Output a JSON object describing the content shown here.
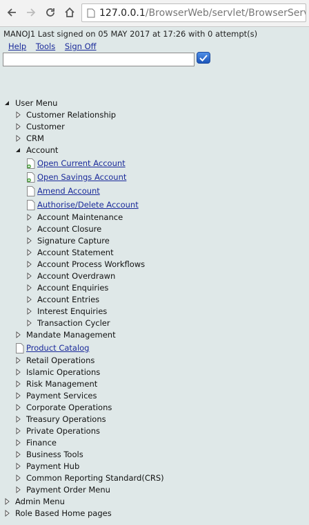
{
  "browser": {
    "url_host": "127.0.0.1",
    "url_path": "/BrowserWeb/servlet/BrowserServlet"
  },
  "header": {
    "signed_in_text": "MANOJ1 Last signed on 05 MAY 2017 at 17:26 with 0 attempt(s)",
    "links": [
      "Help",
      "Tools",
      "Sign Off"
    ],
    "command_value": ""
  },
  "menu": {
    "root": "User Menu",
    "items_level1_top": [
      "Customer Relationship",
      "Customer",
      "CRM"
    ],
    "account": "Account",
    "account_links": [
      "Open Current Account",
      "Open Savings Account",
      "Amend Account",
      "Authorise/Delete Account"
    ],
    "account_sub": [
      "Account Maintenance",
      "Account Closure",
      "Signature Capture",
      "Account Statement",
      "Account Process Workflows",
      "Account Overdrawn",
      "Account Enquiries",
      "Account Entries",
      "Interest Enquiries",
      "Transaction Cycler"
    ],
    "mandate": "Mandate Management",
    "product_catalog": "Product Catalog",
    "items_level1_bottom": [
      "Retail Operations",
      "Islamic Operations",
      "Risk Management",
      "Payment Services",
      "Corporate Operations",
      "Treasury Operations",
      "Private Operations",
      "Finance",
      "Business Tools",
      "Payment Hub",
      "Common Reporting Standard(CRS)",
      "Payment Order Menu"
    ],
    "admin": "Admin Menu",
    "role_based": "Role Based Home pages"
  }
}
